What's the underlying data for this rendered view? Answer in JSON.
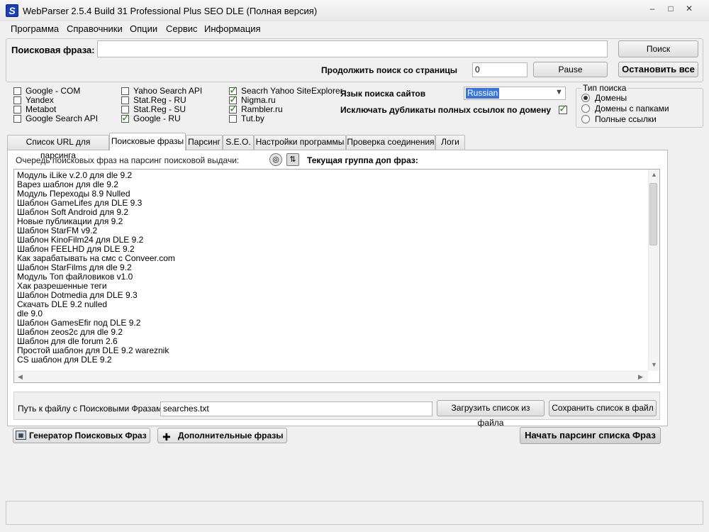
{
  "window": {
    "title": "WebParser 2.5.4 Build 31 Professional Plus SEO DLE (Полная версия)",
    "minimize": "–",
    "maximize": "□",
    "close": "✕"
  },
  "menu": [
    "Программа",
    "Справочники",
    "Опции",
    "Сервис",
    "Информация"
  ],
  "search": {
    "phrase_label": "Поисковая фраза:",
    "phrase_value": "",
    "search_button": "Поиск",
    "continue_label": "Продолжить поиск со страницы",
    "page_value": "0",
    "pause_button": "Pause",
    "stop_button": "Остановить все"
  },
  "engines": [
    {
      "label": "Google - COM",
      "checked": false
    },
    {
      "label": "Yandex",
      "checked": false
    },
    {
      "label": "Metabot",
      "checked": false
    },
    {
      "label": "Google Search API",
      "checked": false
    },
    {
      "label": "Yahoo Search API",
      "checked": false
    },
    {
      "label": "Stat.Reg - RU",
      "checked": false
    },
    {
      "label": "Stat.Reg - SU",
      "checked": false
    },
    {
      "label": "Google - RU",
      "checked": true
    },
    {
      "label": "Seacrh Yahoo SiteExplorer",
      "checked": true
    },
    {
      "label": "Nigma.ru",
      "checked": true
    },
    {
      "label": "Rambler.ru",
      "checked": true
    },
    {
      "label": "Tut.by",
      "checked": false
    }
  ],
  "options": {
    "language_label": "Язык поиска сайтов",
    "language_value": "Russian",
    "dedupe_label": "Исключать дубликаты полных ссылок по домену",
    "dedupe_checked": true
  },
  "search_type": {
    "legend": "Тип поиска",
    "options": [
      {
        "label": "Домены",
        "selected": true
      },
      {
        "label": "Домены с папками",
        "selected": false
      },
      {
        "label": "Полные ссылки",
        "selected": false
      }
    ]
  },
  "tabs": [
    {
      "label": "Список URL для парсинга",
      "active": false
    },
    {
      "label": "Поисковые фразы",
      "active": true
    },
    {
      "label": "Парсинг",
      "active": false
    },
    {
      "label": "S.E.O.",
      "active": false
    },
    {
      "label": "Настройки программы",
      "active": false
    },
    {
      "label": "Проверка соединения",
      "active": false
    },
    {
      "label": "Логи",
      "active": false
    }
  ],
  "phrases_tab": {
    "queue_label": "Очередь поисковых фраз на парсинг поисковой выдачи:",
    "current_group_label": "Текущая группа доп фраз:",
    "queue": [
      "Модуль iLike v.2.0 для dle 9.2",
      "Варез шаблон для dle 9.2",
      "Модуль Переходы 8.9 Nulled",
      "Шаблон GameLifes для DLE 9.3",
      "Шаблон Soft Android для 9.2",
      "Новые публикации для 9.2",
      "Шаблон StarFM v9.2",
      "Шаблон KinoFilm24 для DLE 9.2",
      "Шаблон FEELHD для DLE 9.2",
      "Как зарабатывать на смс с Conveer.com",
      "Шаблон StarFilms для dle 9.2",
      "Модуль Топ файловиков v1.0",
      "Хак разрешенные теги",
      "Шаблон Dotmedia для DLE 9.3",
      "Скачать DLE 9.2 nulled",
      "dle 9.0",
      "Шаблон GamesEfir под DLE 9.2",
      "Шаблон zeos2c для dle 9.2",
      "Шаблон для dle forum 2.6",
      "Простой шаблон для DLE 9.2 wareznik",
      "CS шаблон для DLE 9.2"
    ],
    "path_label": "Путь к файлу с Поисковыми Фразами",
    "path_value": "searches.txt",
    "load_button": "Загрузить список из файла",
    "save_button": "Сохранить список в файл"
  },
  "bottom": {
    "generator_button": "Генератор Поисковых Фраз",
    "extra_button": "Дополнительные фразы",
    "start_button": "Начать парсинг списка Фраз"
  },
  "status": {
    "text": ""
  }
}
